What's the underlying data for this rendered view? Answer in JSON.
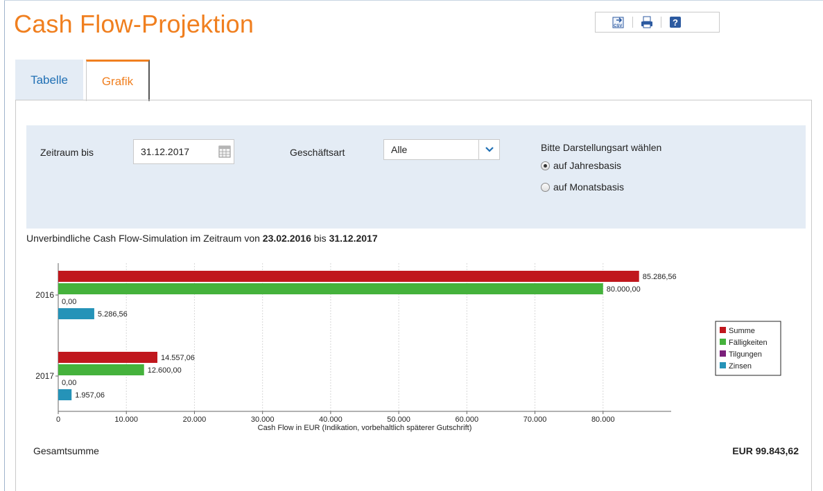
{
  "page": {
    "title": "Cash Flow-Projektion"
  },
  "toolbar": {
    "csv_icon": "csv-export-icon",
    "print_icon": "printer-icon",
    "help_icon": "help-icon",
    "help_glyph": "?"
  },
  "tabs": [
    {
      "label": "Tabelle",
      "active": false
    },
    {
      "label": "Grafik",
      "active": true
    }
  ],
  "filters": {
    "period_label": "Zeitraum bis",
    "period_value": "31.12.2017",
    "type_label": "Geschäftsart",
    "type_value": "Alle",
    "mode_label": "Bitte Darstellungsart wählen",
    "mode_options": [
      {
        "label": "auf Jahresbasis",
        "checked": true
      },
      {
        "label": "auf Monatsbasis",
        "checked": false
      }
    ]
  },
  "simulation": {
    "prefix": "Unverbindliche Cash Flow-Simulation im Zeitraum von",
    "from": "23.02.2016",
    "middle": "bis",
    "to": "31.12.2017"
  },
  "chart_data": {
    "type": "bar",
    "orientation": "horizontal",
    "categories": [
      "2016",
      "2017"
    ],
    "series": [
      {
        "name": "Summe",
        "values": [
          85286.56,
          14557.06
        ],
        "labels": [
          "85.286,56",
          "14.557,06"
        ],
        "color": "#c0171d"
      },
      {
        "name": "Fälligkeiten",
        "values": [
          80000.0,
          12600.0
        ],
        "labels": [
          "80.000,00",
          "12.600,00"
        ],
        "color": "#45b23c"
      },
      {
        "name": "Tilgungen",
        "values": [
          0,
          0
        ],
        "labels": [
          "0,00",
          "0,00"
        ],
        "color": "#7a1f7a"
      },
      {
        "name": "Zinsen",
        "values": [
          5286.56,
          1957.06
        ],
        "labels": [
          "5.286,56",
          "1.957,06"
        ],
        "color": "#2593b8"
      }
    ],
    "xlabel": "Cash Flow in EUR (Indikation, vorbehaltlich späterer Gutschrift)",
    "xlim": [
      0,
      90000
    ],
    "xticks": [
      0,
      10000,
      20000,
      30000,
      40000,
      50000,
      60000,
      70000,
      80000
    ],
    "xtick_labels": [
      "0",
      "10.000",
      "20.000",
      "30.000",
      "40.000",
      "50.000",
      "60.000",
      "70.000",
      "80.000"
    ],
    "grid": true,
    "legend": "right"
  },
  "total": {
    "label": "Gesamtsumme",
    "value": "EUR 99.843,62"
  }
}
